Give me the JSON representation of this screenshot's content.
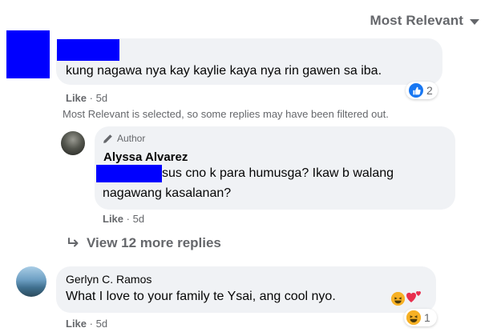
{
  "header": {
    "sort_label": "Most Relevant"
  },
  "comment1": {
    "text": "kung nagawa nya kay kaylie kaya nya rin gawen sa iba.",
    "like_label": "Like",
    "time": "5d",
    "reaction_count": "2"
  },
  "notice": "Most Relevant is selected, so some replies may have been filtered out.",
  "reply1": {
    "author_badge": "Author",
    "name": "Alyssa Alvarez",
    "text_line1": "sus cno k para humusga? Ikaw b walang",
    "text_line2": "nagawang kasalanan?",
    "like_label": "Like",
    "time": "5d"
  },
  "view_more": {
    "label": "View 12 more replies"
  },
  "comment2": {
    "name": "Gerlyn C. Ramos",
    "text": "What I love to your family te Ysai, ang cool nyo.",
    "like_label": "Like",
    "time": "5d",
    "reaction_count": "1"
  },
  "meta_separator": "·",
  "colors": {
    "redaction": "#0000ff",
    "bubble": "#f0f2f5",
    "secondary_text": "#65676b",
    "like_blue": "#1877f2"
  },
  "icons": [
    "chevron-down-icon",
    "like-reaction-icon",
    "pencil-icon",
    "reply-arrow-icon",
    "haha-reaction-icon",
    "heart-reaction-icon"
  ]
}
